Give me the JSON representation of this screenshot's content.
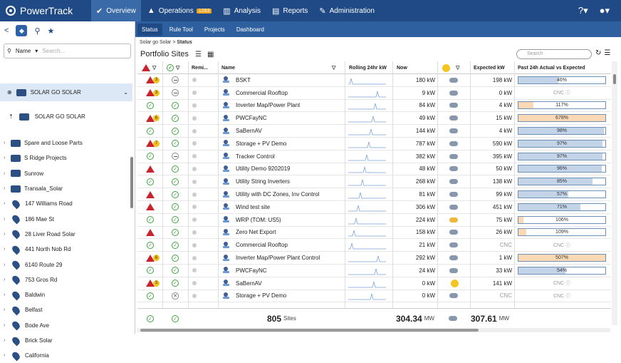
{
  "app": {
    "name": "PowerTrack"
  },
  "nav": [
    {
      "label": "Overview",
      "icon": "check-circle-icon",
      "active": true
    },
    {
      "label": "Operations",
      "icon": "alert-triangle-icon",
      "badge": "1293"
    },
    {
      "label": "Analysis",
      "icon": "bar-chart-icon"
    },
    {
      "label": "Reports",
      "icon": "document-icon"
    },
    {
      "label": "Administration",
      "icon": "wrench-icon"
    }
  ],
  "search": {
    "field": "Name",
    "placeholder": "Search..."
  },
  "pinned": [
    {
      "label": "SOLAR GO SOLAR"
    },
    {
      "label": "SOLAR GO SOLAR"
    }
  ],
  "tree": [
    {
      "label": "Spare and Loose Parts",
      "type": "briefcase"
    },
    {
      "label": "S Ridge Projects",
      "type": "briefcase"
    },
    {
      "label": "Sunrow",
      "type": "briefcase"
    },
    {
      "label": "Transala_Solar",
      "type": "briefcase"
    },
    {
      "label": "147 Williams Road",
      "type": "pin"
    },
    {
      "label": "186 Mae St",
      "type": "pin"
    },
    {
      "label": "28 Liver Road Solar",
      "type": "pin"
    },
    {
      "label": "441 North Nob Rd",
      "type": "pin"
    },
    {
      "label": "6140 Route 29",
      "type": "pin"
    },
    {
      "label": "753 Gros Rd",
      "type": "pin"
    },
    {
      "label": "Baldwin",
      "type": "pin"
    },
    {
      "label": "Belfast",
      "type": "pin"
    },
    {
      "label": "Bode Ave",
      "type": "pin"
    },
    {
      "label": "Brick Solar",
      "type": "pin"
    },
    {
      "label": "California",
      "type": "pin"
    }
  ],
  "subtabs": [
    {
      "label": "Status",
      "active": true
    },
    {
      "label": "Rule Tool"
    },
    {
      "label": "Projects"
    },
    {
      "label": "Dashboard"
    }
  ],
  "breadcrumb": {
    "root": "Solar go Solar",
    "sep": ">",
    "current": "Status"
  },
  "page": {
    "title": "Portfolio Sites"
  },
  "grid_search": {
    "placeholder": "Search"
  },
  "columns": {
    "remi": "Remi...",
    "name": "Name",
    "rolling": "Rolling 24hr kW",
    "now": "Now",
    "expected": "Expected kW",
    "past": "Past 24h Actual vs Expected"
  },
  "rows": [
    {
      "alert": "warn",
      "alertnum": "3",
      "status": "minus",
      "name": "BSKT",
      "now": "180 kW",
      "weather": "cloud",
      "exp": "198 kW",
      "pct": "46%",
      "val": 0.46,
      "color": "#c3d3e8"
    },
    {
      "alert": "warn",
      "alertnum": "3",
      "status": "minus",
      "name": "Commercial Rooftop",
      "now": "9 kW",
      "weather": "cloud",
      "exp": "0 kW",
      "pct": "CNC",
      "val": null,
      "color": ""
    },
    {
      "alert": "ok",
      "status": "ok",
      "name": "Inverter Map/Power Plant",
      "now": "84 kW",
      "weather": "cloud",
      "exp": "4 kW",
      "pct": "117%",
      "val": 0.17,
      "color": "#fbd9b4"
    },
    {
      "alert": "warn",
      "alertnum": "6",
      "status": "ok",
      "name": "PWCFayNC",
      "now": "49 kW",
      "weather": "cloud",
      "exp": "15 kW",
      "pct": "678%",
      "val": 1,
      "color": "#fbd9b4"
    },
    {
      "alert": "ok",
      "status": "ok",
      "name": "SaBernAV",
      "now": "144 kW",
      "weather": "cloud",
      "exp": "4 kW",
      "pct": "98%",
      "val": 0.98,
      "color": "#c3d3e8"
    },
    {
      "alert": "warn",
      "alertnum": "7",
      "status": "ok",
      "name": "Storage + PV Demo",
      "now": "787 kW",
      "weather": "cloud",
      "exp": "590 kW",
      "pct": "97%",
      "val": 0.97,
      "color": "#c3d3e8"
    },
    {
      "alert": "ok",
      "status": "minus",
      "name": "Tracker Control",
      "now": "382 kW",
      "weather": "cloud",
      "exp": "395 kW",
      "pct": "97%",
      "val": 0.97,
      "color": "#c3d3e8"
    },
    {
      "alert": "warn",
      "status": "ok",
      "name": "Utility Demo 9202019",
      "now": "48 kW",
      "weather": "cloud",
      "exp": "50 kW",
      "pct": "96%",
      "val": 0.96,
      "color": "#c3d3e8"
    },
    {
      "alert": "ok",
      "status": "ok",
      "name": "Utility String Inverters",
      "now": "268 kW",
      "weather": "cloud",
      "exp": "138 kW",
      "pct": "85%",
      "val": 0.85,
      "color": "#c3d3e8"
    },
    {
      "alert": "warn",
      "status": "ok",
      "name": "Utility with DC Zones, Inv Control",
      "now": "81 kW",
      "weather": "cloud",
      "exp": "99 kW",
      "pct": "57%",
      "val": 0.57,
      "color": "#c3d3e8"
    },
    {
      "alert": "warn",
      "status": "ok",
      "name": "Wind test site",
      "now": "306 kW",
      "weather": "cloud",
      "exp": "451 kW",
      "pct": "71%",
      "val": 0.71,
      "color": "#c3d3e8"
    },
    {
      "alert": "ok",
      "status": "ok",
      "name": "WRP (TOM: US5)",
      "now": "224 kW",
      "weather": "partly",
      "exp": "75 kW",
      "pct": "106%",
      "val": 0.06,
      "color": "#fbd9b4"
    },
    {
      "alert": "warn",
      "status": "ok",
      "name": "Zero Net Export",
      "now": "158 kW",
      "weather": "cloud",
      "exp": "26 kW",
      "pct": "109%",
      "val": 0.09,
      "color": "#fbd9b4"
    },
    {
      "alert": "ok",
      "status": "ok",
      "name": "Commercial Rooftop",
      "now": "21 kW",
      "weather": "cloud",
      "exp": "CNC",
      "pct": "CNC",
      "val": null,
      "color": ""
    },
    {
      "alert": "warn",
      "alertnum": "6",
      "status": "ok",
      "name": "Inverter Map/Power Plant Control",
      "now": "292 kW",
      "weather": "cloud",
      "exp": "1 kW",
      "pct": "507%",
      "val": 1,
      "color": "#fbd9b4"
    },
    {
      "alert": "ok",
      "status": "ok",
      "name": "PWCFayNC",
      "now": "24 kW",
      "weather": "cloud",
      "exp": "33 kW",
      "pct": "54%",
      "val": 0.54,
      "color": "#c3d3e8"
    },
    {
      "alert": "warn",
      "alertnum": "3",
      "status": "ok",
      "name": "SaBernAV",
      "now": "0 kW",
      "weather": "sun",
      "exp": "141 kW",
      "pct": "CNC",
      "val": null,
      "color": ""
    },
    {
      "alert": "ok",
      "status": "x",
      "name": "Storage + PV Demo",
      "now": "0 kW",
      "weather": "cloud",
      "exp": "CNC",
      "pct": "CNC",
      "val": null,
      "color": ""
    }
  ],
  "footer": {
    "sites": "805",
    "sites_unit": "Sites",
    "now": "304.34",
    "now_unit": "MW",
    "expected": "307.61",
    "exp_unit": "MW"
  }
}
